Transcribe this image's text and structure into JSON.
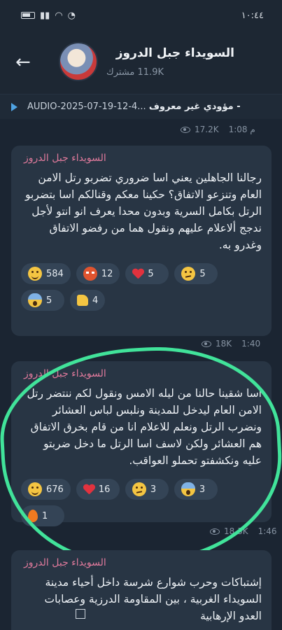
{
  "status_bar": {
    "time": "١٠:٤٤",
    "battery": "64"
  },
  "header": {
    "title": "السويداء جبل الدروز",
    "subscribers": "11.9K مشترك"
  },
  "pinned": {
    "sender": "مؤودي غير معروف -",
    "file": "AUDIO-2025-07-19-12-4..."
  },
  "pinned_meta": {
    "views": "17.2K",
    "time": "1:08 م"
  },
  "messages": [
    {
      "sender": "السويداء جبل الدروز",
      "text": "رجالنا الجاهلين يعني اسا ضروري تضربو رتل الامن العام وتنزعو الاتفاق؟ حكينا معكم وقنالكم اسا بتضربو الرتل بكامل السرية وبدون محدا يعرف انو انتو لأجل ندجج ألاعلام عليهم ونقول هما من رفضو الاتفاق وغدرو به.",
      "reactions": [
        {
          "emoji": "laugh",
          "count": "584"
        },
        {
          "emoji": "angry",
          "count": "12"
        },
        {
          "emoji": "heart",
          "count": "5"
        },
        {
          "emoji": "thinking",
          "count": "5"
        },
        {
          "emoji": "scream",
          "count": "5"
        },
        {
          "emoji": "thumbs-up",
          "count": "4"
        }
      ],
      "views": "18K",
      "time": "1:40"
    },
    {
      "sender": "السويداء جبل الدروز",
      "text": "اسا شقينا حالنا من ليله الامس ونقول لكم ننتضر رتل الامن العام ليدخل للمدينة ونلبس لباس العشائر ونضرب الرتل ونعلم للاعلام انا من قام بخرق الاتفاق هم العشائر ولكن لاسف اسا الرتل ما دخل ضربتو عليه ونكشفتو تحملو العواقب.",
      "reactions": [
        {
          "emoji": "laugh",
          "count": "676"
        },
        {
          "emoji": "heart",
          "count": "16"
        },
        {
          "emoji": "thinking",
          "count": "3"
        },
        {
          "emoji": "scream",
          "count": "3"
        },
        {
          "emoji": "fire",
          "count": "1"
        }
      ],
      "views": "18.3K",
      "time": "1:46"
    },
    {
      "sender": "السويداء جبل الدروز",
      "text": "إشتباكات وحرب شوارع شرسة داخل أحياء مدينة السويداء الغربية ، بين المقاومة الدرزية وعصابات العدو الإرهابية"
    }
  ],
  "colors": {
    "highlight": "#41e39a",
    "sender": "#e07a9c",
    "bubble": "#283544"
  }
}
